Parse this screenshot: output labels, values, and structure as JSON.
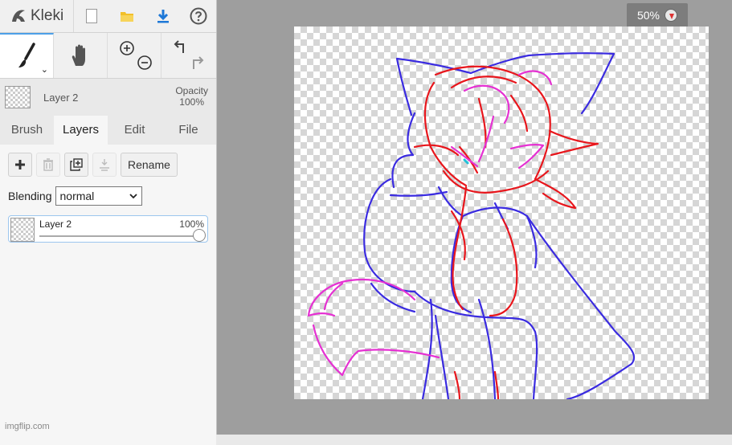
{
  "app": {
    "name": "Kleki"
  },
  "toolbar_top": {
    "new_icon": "new-file-icon",
    "open_icon": "open-folder-icon",
    "save_icon": "download-icon",
    "help_icon": "help-icon"
  },
  "tools": {
    "brush_icon": "brush-icon",
    "hand_icon": "hand-icon",
    "zoom_in_icon": "zoom-in-icon",
    "zoom_out_icon": "zoom-out-icon",
    "undo_icon": "undo-icon",
    "redo_icon": "redo-icon"
  },
  "current_layer": {
    "name": "Layer 2",
    "opacity_label": "Opacity",
    "opacity_value": "100%"
  },
  "tabs": [
    {
      "label": "Brush"
    },
    {
      "label": "Layers"
    },
    {
      "label": "Edit"
    },
    {
      "label": "File"
    }
  ],
  "layers_panel": {
    "rename_label": "Rename",
    "blending_label": "Blending",
    "blending_value": "normal",
    "layers": [
      {
        "name": "Layer 2",
        "opacity": "100%",
        "opacity_level": 1.0
      }
    ]
  },
  "zoom": {
    "value": "50%"
  },
  "watermark": "imgflip.com",
  "colors": {
    "accent": "#4ea0e8",
    "stroke_blue": "#3a2be0",
    "stroke_red": "#e8161c",
    "stroke_pink": "#e531d2"
  }
}
